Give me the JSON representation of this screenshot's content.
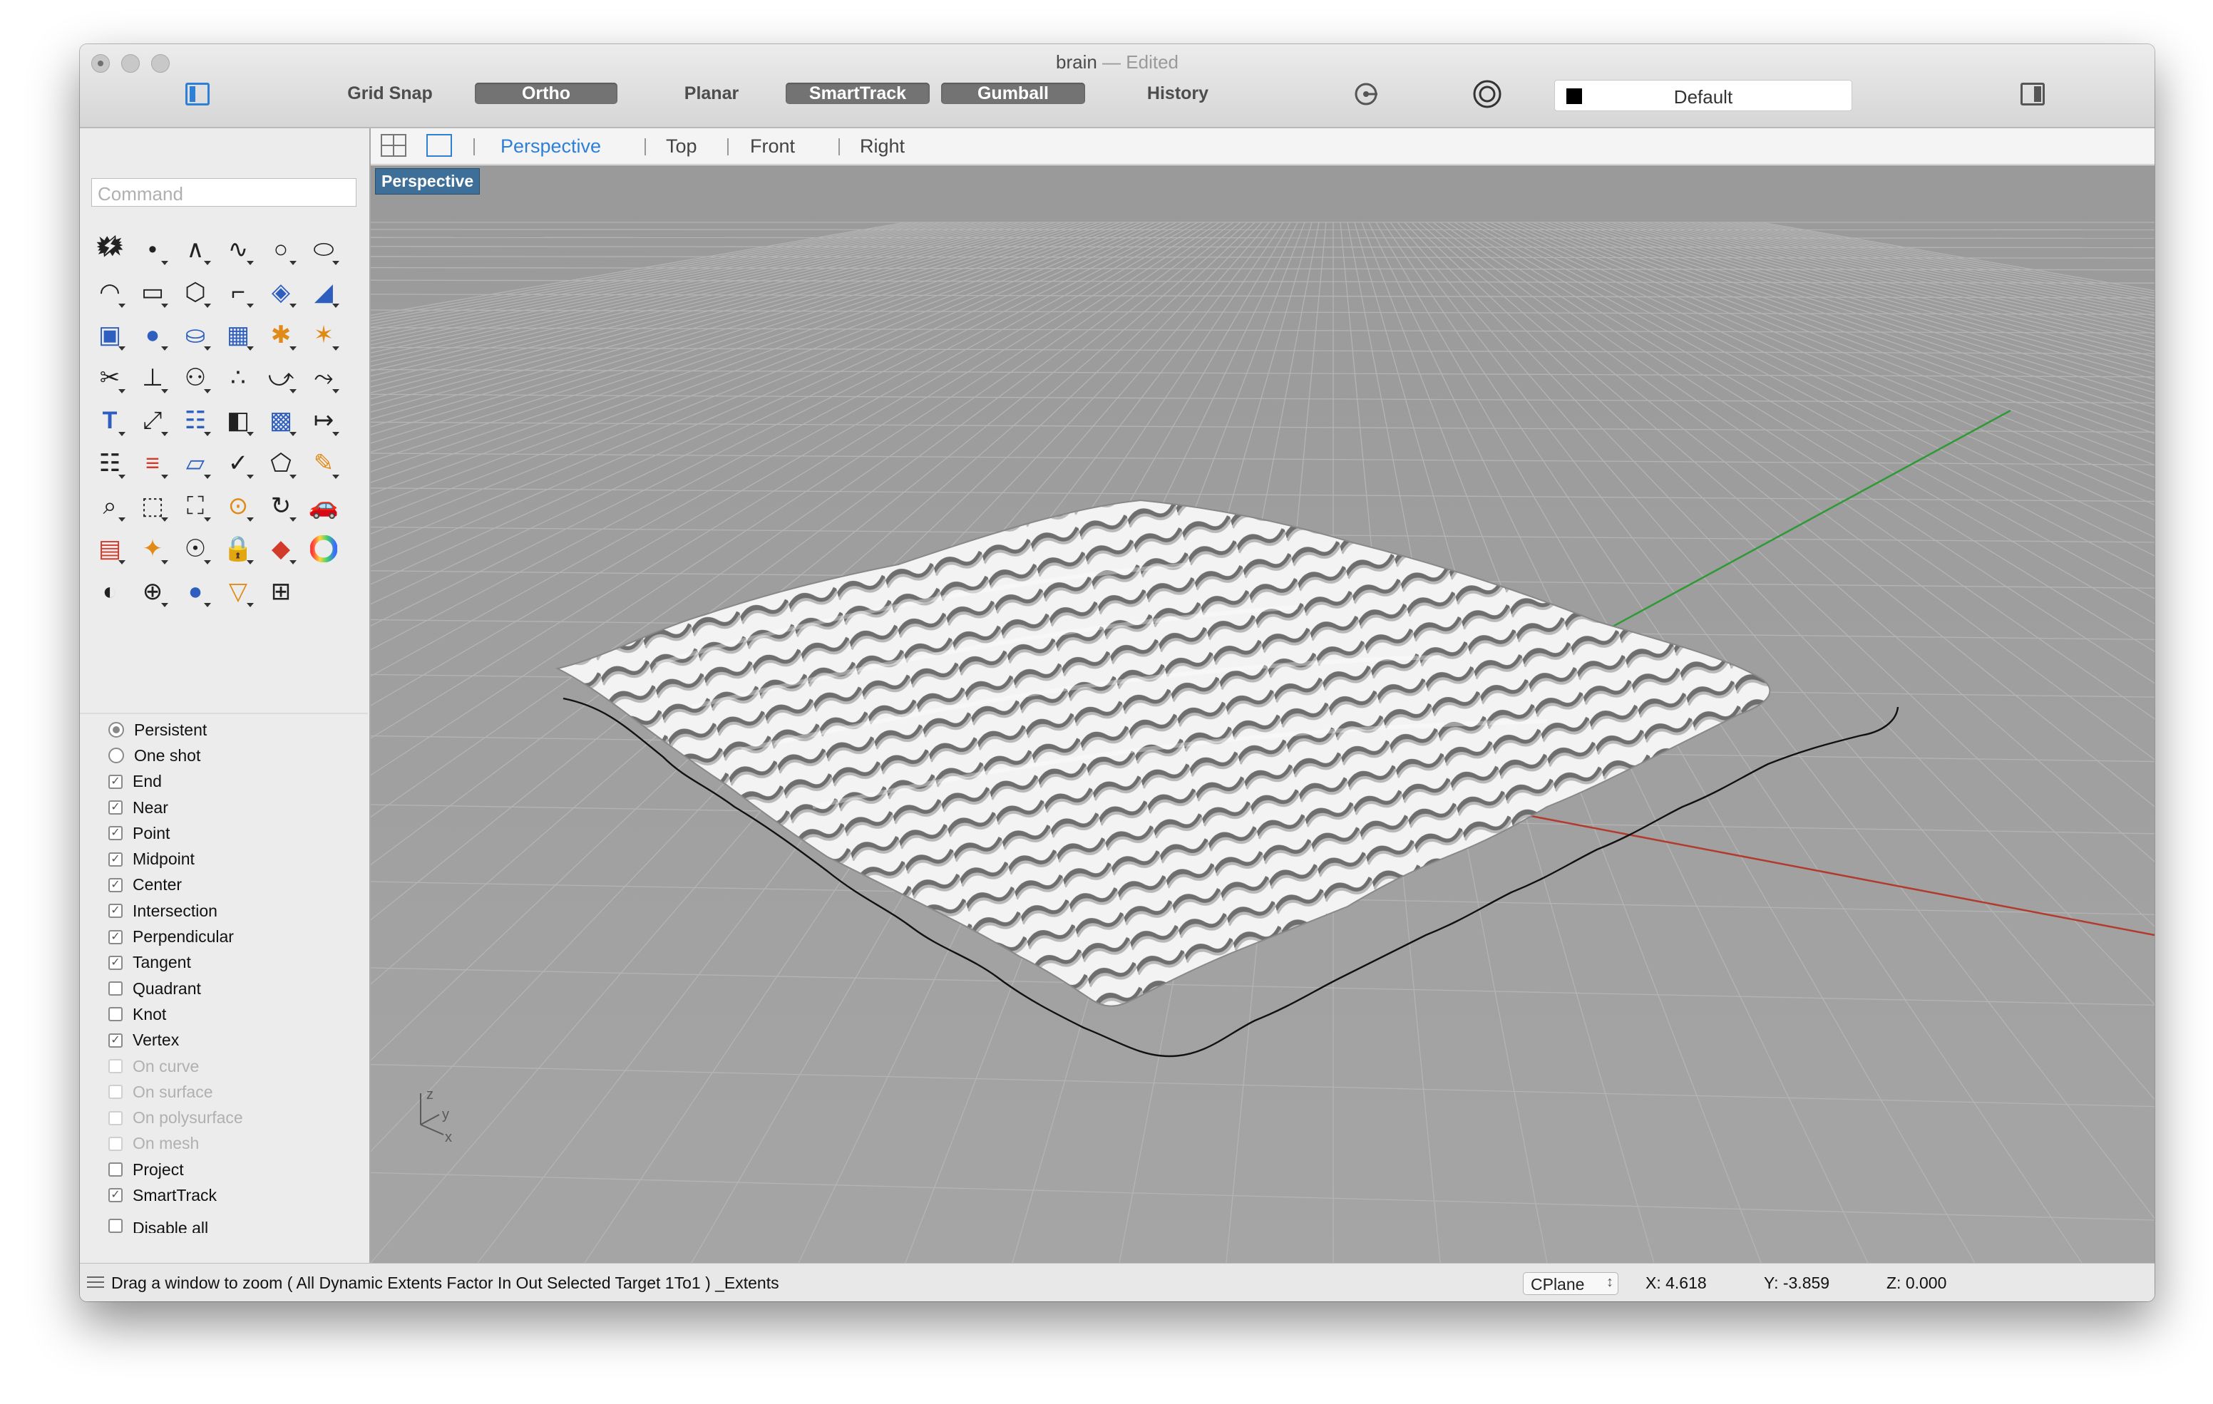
{
  "window": {
    "title": "brain",
    "separator": "—",
    "status": "Edited"
  },
  "toolbar": {
    "grid_snap": "Grid Snap",
    "ortho": "Ortho",
    "planar": "Planar",
    "smarttrack": "SmartTrack",
    "gumball": "Gumball",
    "history": "History",
    "layer": "Default",
    "layer_color": "#000000"
  },
  "command": {
    "placeholder": "Command"
  },
  "tools": [
    "select-arrow-icon",
    "point-icon",
    "polyline-icon",
    "curve-icon",
    "circle-icon",
    "ellipse-icon",
    "arc-icon",
    "rectangle-icon",
    "polygon-icon",
    "fillet-curve-icon",
    "surface-from-points-icon",
    "sweep-surface-icon",
    "box-icon",
    "sphere-boolean-icon",
    "cylinder-icon",
    "mesh-plane-icon",
    "explode-icon",
    "split-icon",
    "trim-icon",
    "extend-icon",
    "boolean-union-icon",
    "boolean-split-icon",
    "fillet-icon",
    "blend-icon",
    "text-icon",
    "scale-icon",
    "array-icon",
    "mirror-icon",
    "solid-tools-icon",
    "dimension-icon",
    "grid-array-icon",
    "align-icon",
    "unroll-icon",
    "check-icon",
    "analyze-icon",
    "properties-icon",
    "zoom-icon",
    "zoom-window-icon",
    "zoom-extents-icon",
    "zoom-selected-icon",
    "rotate-view-icon",
    "car-icon",
    "named-cplane-icon",
    "snap-icon",
    "light-icon",
    "lock-icon",
    "render-icon",
    "color-wheel-icon",
    "sphere-view-icon",
    "grid-sphere-icon",
    "render-sphere-icon",
    "camera-icon",
    "layout-icon"
  ],
  "snap_modes": {
    "persistent": "Persistent",
    "one_shot": "One shot",
    "items": [
      {
        "label": "End",
        "checked": true,
        "enabled": true
      },
      {
        "label": "Near",
        "checked": true,
        "enabled": true
      },
      {
        "label": "Point",
        "checked": true,
        "enabled": true
      },
      {
        "label": "Midpoint",
        "checked": true,
        "enabled": true
      },
      {
        "label": "Center",
        "checked": true,
        "enabled": true
      },
      {
        "label": "Intersection",
        "checked": true,
        "enabled": true
      },
      {
        "label": "Perpendicular",
        "checked": true,
        "enabled": true
      },
      {
        "label": "Tangent",
        "checked": true,
        "enabled": true
      },
      {
        "label": "Quadrant",
        "checked": false,
        "enabled": true
      },
      {
        "label": "Knot",
        "checked": false,
        "enabled": true
      },
      {
        "label": "Vertex",
        "checked": true,
        "enabled": true
      },
      {
        "label": "On curve",
        "checked": false,
        "enabled": false
      },
      {
        "label": "On surface",
        "checked": false,
        "enabled": false
      },
      {
        "label": "On polysurface",
        "checked": false,
        "enabled": false
      },
      {
        "label": "On mesh",
        "checked": false,
        "enabled": false
      },
      {
        "label": "Project",
        "checked": false,
        "enabled": true
      },
      {
        "label": "SmartTrack",
        "checked": true,
        "enabled": true
      },
      {
        "label": "Disable all",
        "checked": false,
        "enabled": true
      }
    ]
  },
  "viewports": {
    "tabs": [
      "Perspective",
      "Top",
      "Front",
      "Right"
    ],
    "active": "Perspective",
    "label": "Perspective",
    "axis_z": "z",
    "axis_y": "y",
    "axis_x": "x"
  },
  "status": {
    "prompt": "Drag a window to zoom ( All Dynamic Extents Factor In Out Selected Target 1To1 ) _Extents",
    "cplane": "CPlane",
    "x": "X: 4.618",
    "y": "Y: -3.859",
    "z": "Z: 0.000"
  }
}
